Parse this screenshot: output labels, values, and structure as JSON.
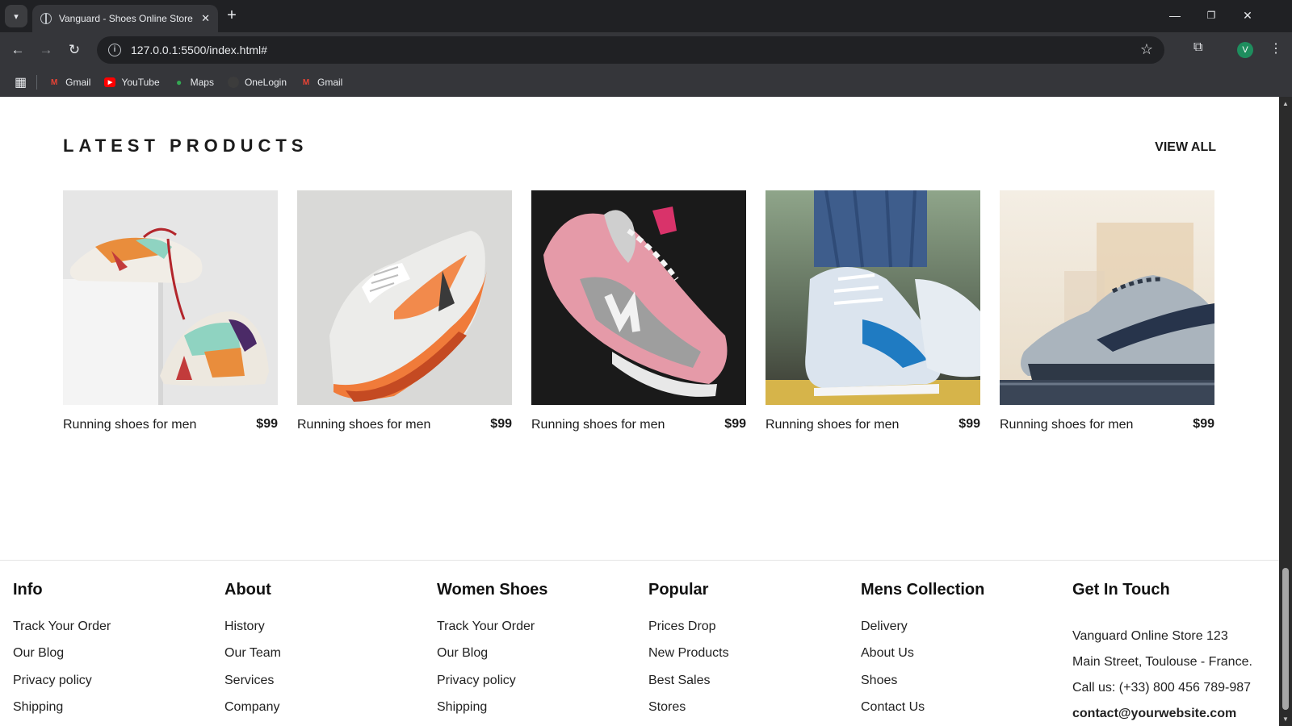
{
  "browser": {
    "tab_title": "Vanguard - Shoes Online Store",
    "tab_close": "✕",
    "new_tab": "+",
    "url": "127.0.0.1:5500/index.html#",
    "profile_initial": "V",
    "window_controls": [
      "—",
      "❐",
      "✕"
    ],
    "bookmarks": [
      {
        "label": "Gmail",
        "icon": "gmail-icon"
      },
      {
        "label": "YouTube",
        "icon": "youtube-icon"
      },
      {
        "label": "Maps",
        "icon": "maps-icon"
      },
      {
        "label": "OneLogin",
        "icon": "onelogin-icon"
      },
      {
        "label": "Gmail",
        "icon": "gmail-icon"
      }
    ]
  },
  "page": {
    "section_title": "LATEST PRODUCTS",
    "view_all": "VIEW ALL",
    "products": [
      {
        "name": "Running shoes for men",
        "price": "$99"
      },
      {
        "name": "Running shoes for men",
        "price": "$99"
      },
      {
        "name": "Running shoes for men",
        "price": "$99"
      },
      {
        "name": "Running shoes for men",
        "price": "$99"
      },
      {
        "name": "Running shoes for men",
        "price": "$99"
      }
    ]
  },
  "footer": {
    "columns": [
      {
        "title": "Info",
        "links": [
          "Track Your Order",
          "Our Blog",
          "Privacy policy",
          "Shipping"
        ]
      },
      {
        "title": "About",
        "links": [
          "History",
          "Our Team",
          "Services",
          "Company"
        ]
      },
      {
        "title": "Women Shoes",
        "links": [
          "Track Your Order",
          "Our Blog",
          "Privacy policy",
          "Shipping"
        ]
      },
      {
        "title": "Popular",
        "links": [
          "Prices Drop",
          "New Products",
          "Best Sales",
          "Stores"
        ]
      },
      {
        "title": "Mens Collection",
        "links": [
          "Delivery",
          "About Us",
          "Shoes",
          "Contact Us"
        ]
      }
    ],
    "contact": {
      "title": "Get In Touch",
      "lines": [
        "Vanguard Online Store 123",
        "Main Street, Toulouse - France.",
        "Call us: (+33) 800 456 789-987",
        "contact@yourwebsite.com"
      ]
    }
  }
}
